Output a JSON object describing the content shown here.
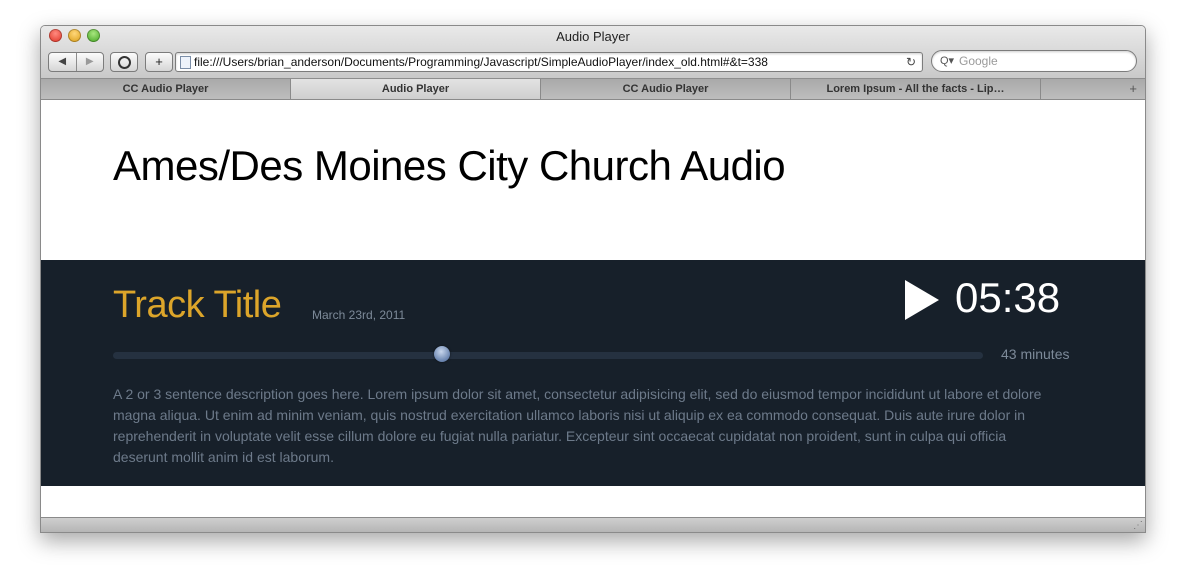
{
  "window": {
    "title": "Audio Player"
  },
  "toolbar": {
    "back_icon": "back-arrow-icon",
    "forward_icon": "forward-arrow-icon",
    "back_glyph": "◀",
    "forward_glyph": "▶",
    "new_tab_glyph": "+",
    "url": "file:///Users/brian_anderson/Documents/Programming/Javascript/SimpleAudioPlayer/index_old.html#&t=338",
    "reload_glyph": "↻",
    "search_placeholder": "Google",
    "search_glyph": "Q▾"
  },
  "tabs": [
    {
      "label": "CC Audio Player",
      "active": false
    },
    {
      "label": "Audio Player",
      "active": true
    },
    {
      "label": "CC Audio Player",
      "active": false
    },
    {
      "label": "Lorem Ipsum - All the facts - Lip…",
      "active": false
    }
  ],
  "tabbar": {
    "plus_glyph": "+"
  },
  "page": {
    "title": "Ames/Des Moines City Church Audio"
  },
  "player": {
    "track_title": "Track Title",
    "date": "March 23rd, 2011",
    "time": "05:38",
    "duration": "43 minutes",
    "progress": 0.378,
    "description": "A 2 or 3 sentence description goes here. Lorem ipsum dolor sit amet, consectetur adipisicing elit, sed do eiusmod tempor incididunt ut labore et dolore magna aliqua. Ut enim ad minim veniam, quis nostrud exercitation ullamco laboris nisi ut aliquip ex ea commodo consequat. Duis aute irure dolor in reprehenderit in voluptate velit esse cillum dolore eu fugiat nulla pariatur. Excepteur sint occaecat cupidatat non proident, sunt in culpa qui officia deserunt mollit anim id est laborum.",
    "accent_color": "#dca52a",
    "background_color": "#17202a"
  },
  "statusbar": {
    "grip_glyph": "⋰"
  }
}
